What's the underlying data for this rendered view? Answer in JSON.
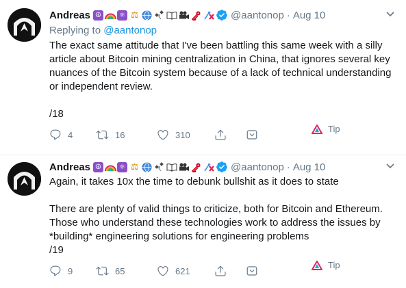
{
  "tweets": [
    {
      "display_name": "Andreas",
      "emojis": [
        "peace-symbol",
        "rainbow",
        "atom-symbol",
        "balance-scale",
        "globe-with-meridians",
        "satellite",
        "open-book",
        "movie-camera",
        "key",
        "pin-and-cross",
        "verified-badge"
      ],
      "handle": "@aantonop",
      "separator": "·",
      "time": "Aug 10",
      "reply_prefix": "Replying to",
      "reply_mention": "@aantonop",
      "paragraphs": [
        "The exact same attitude that I've been battling this same week with a silly article about Bitcoin mining centralization in China, that ignores several key nuances of the Bitcoin system because of a lack of technical understanding or independent review.",
        "",
        "/18"
      ],
      "actions": {
        "replies": "4",
        "retweets": "16",
        "likes": "310",
        "tip_label": "Tip"
      }
    },
    {
      "display_name": "Andreas",
      "emojis": [
        "peace-symbol",
        "rainbow",
        "atom-symbol",
        "balance-scale",
        "globe-with-meridians",
        "satellite",
        "open-book",
        "movie-camera",
        "key",
        "pin-and-cross",
        "verified-badge"
      ],
      "handle": "@aantonop",
      "separator": "·",
      "time": "Aug 10",
      "paragraphs": [
        "Again, it takes 10x the time to debunk bullshit as it does to state",
        "",
        "There are plenty of valid things to criticize, both for Bitcoin and Ethereum. Those who understand these technologies work to address the issues by *building* engineering solutions for engineering problems",
        "/19"
      ],
      "actions": {
        "replies": "9",
        "retweets": "65",
        "likes": "621",
        "tip_label": "Tip"
      }
    }
  ],
  "colors": {
    "text": "#14171a",
    "secondary": "#657786",
    "link": "#1b95e0",
    "verified": "#1da1f2",
    "tip_accent": "#e0245e",
    "divider": "#e6ecf0"
  }
}
